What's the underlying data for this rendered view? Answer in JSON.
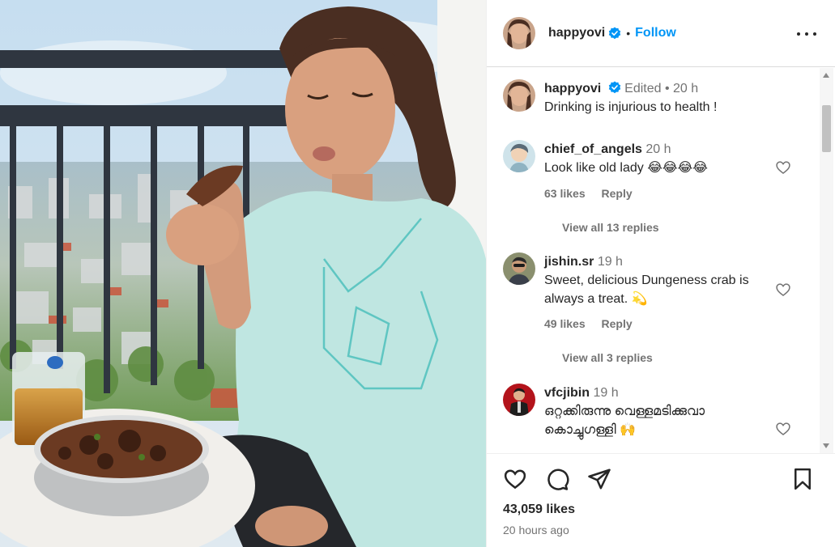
{
  "post": {
    "author": "happyovi",
    "verified": true,
    "follow_label": "Follow",
    "separator": "•",
    "caption": {
      "username": "happyovi",
      "edited_label": "Edited",
      "time": "20 h",
      "text": "Drinking is injurious to health !"
    },
    "comments": [
      {
        "username": "chief_of_angels",
        "time": "20 h",
        "text": "Look like old lady 😂😂😂😂",
        "likes": "63 likes",
        "reply_label": "Reply",
        "view_replies": "View all 13 replies"
      },
      {
        "username": "jishin.sr",
        "time": "19 h",
        "text": "Sweet, delicious Dungeness crab is always a treat. 💫",
        "likes": "49 likes",
        "reply_label": "Reply",
        "view_replies": "View all 3 replies"
      },
      {
        "username": "vfcjibin",
        "time": "19 h",
        "text": "ഒറ്റക്കിരുന്നു വെള്ളമടിക്കുവാ കൊച്ചുഗള്ളി 🙌"
      }
    ],
    "likes_count": "43,059 likes",
    "posted_ago": "20 hours ago"
  },
  "icons": {
    "more": "more-horizontal-icon",
    "like": "heart-icon",
    "comment": "comment-bubble-icon",
    "share": "paper-plane-icon",
    "save": "bookmark-icon",
    "verified": "verified-badge-icon"
  },
  "colors": {
    "link_blue": "#0095f6",
    "text": "#262626",
    "muted": "#737373",
    "verified_blue": "#0095f6"
  }
}
